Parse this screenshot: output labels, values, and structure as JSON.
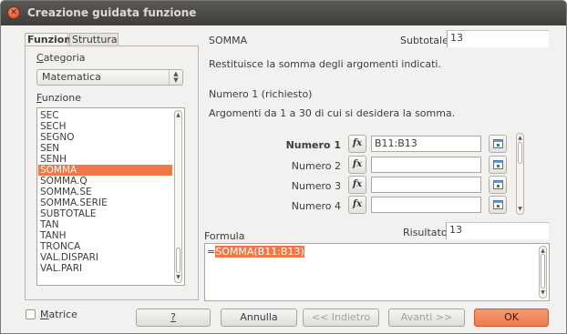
{
  "window": {
    "title": "Creazione guidata funzione"
  },
  "tabs": [
    "Funzioni",
    "Struttura"
  ],
  "category": {
    "label": "Categoria",
    "value": "Matematica"
  },
  "function_list": {
    "label": "Funzione",
    "items": [
      "SEC",
      "SECH",
      "SEGNO",
      "SEN",
      "SENH",
      "SOMMA",
      "SOMMA.Q",
      "SOMMA.SE",
      "SOMMA.SERIE",
      "SUBTOTALE",
      "TAN",
      "TANH",
      "TRONCA",
      "VAL.DISPARI",
      "VAL.PARI"
    ],
    "selected": "SOMMA"
  },
  "function_info": {
    "name": "SOMMA",
    "subtotal_label": "Subtotale",
    "subtotal_value": "13",
    "description": "Restituisce la somma degli argomenti indicati.",
    "arg_heading": "Numero 1 (richiesto)",
    "arg_description": "Argomenti da 1 a 30 di cui si desidera la somma."
  },
  "arguments": [
    {
      "label": "Numero 1",
      "value": "B11:B13"
    },
    {
      "label": "Numero 2",
      "value": ""
    },
    {
      "label": "Numero 3",
      "value": ""
    },
    {
      "label": "Numero 4",
      "value": ""
    }
  ],
  "fx_glyph": "fx",
  "formula": {
    "label": "Formula",
    "result_label": "Risultato",
    "result_value": "13",
    "prefix": "=",
    "body": "SOMMA(B11:B13)"
  },
  "buttons": {
    "matrix": "Matrice",
    "help": "?",
    "cancel": "Annulla",
    "back": "<< Indietro",
    "next": "Avanti >>",
    "ok": "OK"
  },
  "colors": {
    "selection": "#f07746",
    "titlebar": "#3f3e3b",
    "close_button": "#d84b20"
  },
  "icons": [
    "close-icon",
    "fx-icon",
    "shrink-dialog-icon",
    "dropdown-icon"
  ]
}
